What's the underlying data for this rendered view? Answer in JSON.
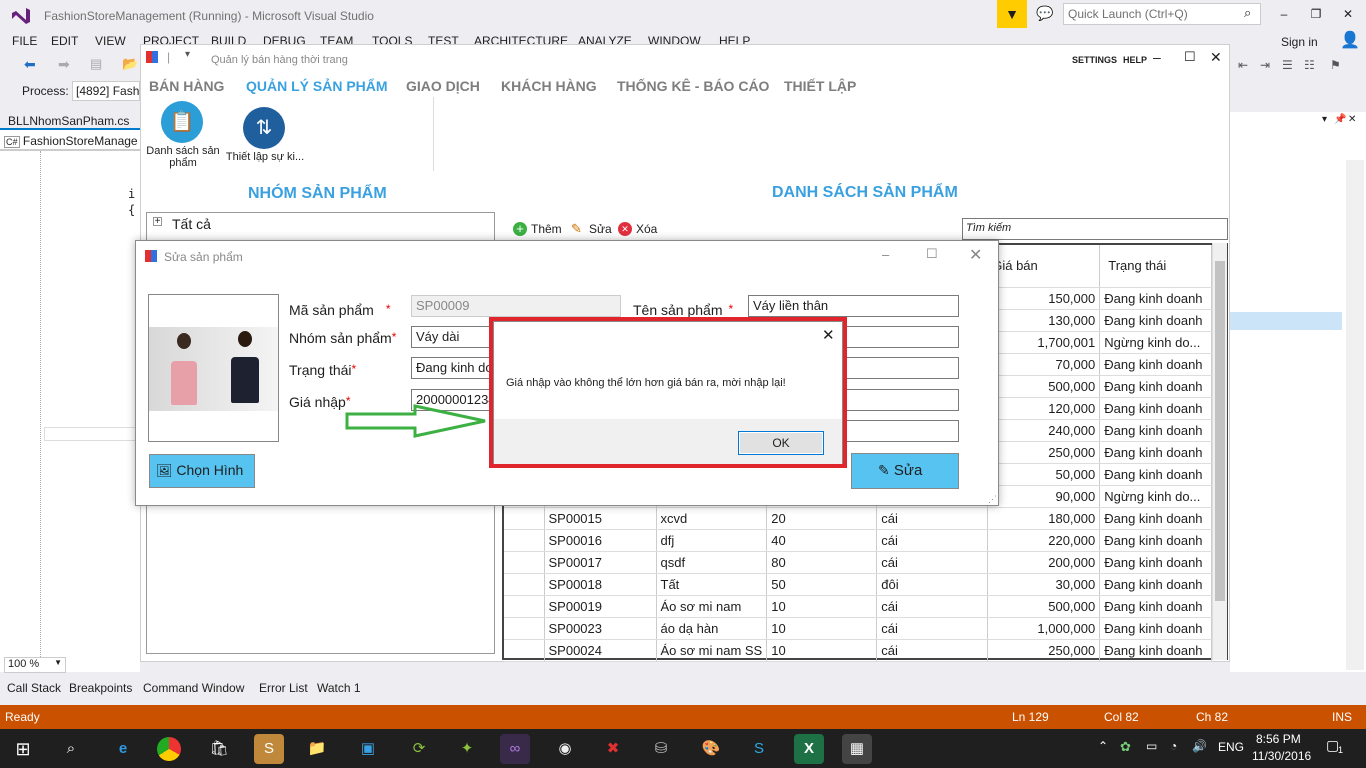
{
  "vs": {
    "title": "FashionStoreManagement (Running) - Microsoft Visual Studio",
    "quick_launch_placeholder": "Quick Launch (Ctrl+Q)",
    "sign_in": "Sign in",
    "menu": [
      "FILE",
      "EDIT",
      "VIEW",
      "PROJECT",
      "BUILD",
      "DEBUG",
      "TEAM",
      "TOOLS",
      "TEST",
      "ARCHITECTURE",
      "ANALYZE",
      "WINDOW",
      "HELP"
    ],
    "process_label": "Process:",
    "process_value": "[4892] Fashi",
    "doc_tab": "BLLNhomSanPham.cs",
    "doc_nav": "FashionStoreManage",
    "code_line1": "i",
    "code_line2": "{",
    "zoom": "100 %",
    "bottom_tabs": [
      "Call Stack",
      "Breakpoints",
      "Command Window",
      "Error List",
      "Watch 1"
    ],
    "status": {
      "ready": "Ready",
      "ln": "Ln 129",
      "col": "Col 82",
      "ch": "Ch 82",
      "ins": "INS"
    }
  },
  "app": {
    "title": "Quản lý bán hàng thời trang",
    "settings": "SETTINGS",
    "help": "HELP",
    "nav": [
      "BÁN HÀNG",
      "QUẢN LÝ SẢN PHẨM",
      "GIAO DỊCH",
      "KHÁCH HÀNG",
      "THỐNG KÊ - BÁO CÁO",
      "THIẾT LẬP"
    ],
    "ribbon": [
      {
        "label": "Danh sách sản phẩm",
        "icon": "clipboard-list-icon"
      },
      {
        "label": "Thiết lập sự ki...",
        "icon": "sort-arrows-icon"
      }
    ],
    "group_title": "NHÓM SẢN PHẨM",
    "list_title": "DANH SÁCH SẢN PHẨM",
    "tree_root": "Tất cả",
    "toolbar": {
      "add": "Thêm",
      "edit": "Sửa",
      "delete": "Xóa"
    },
    "search_placeholder": "Tìm kiếm",
    "columns": {
      "price": "Giá bán",
      "status": "Trạng thái"
    },
    "partial_rows": [
      {
        "price": "150,000",
        "status": "Đang kinh doanh"
      },
      {
        "price": "130,000",
        "status": "Đang kinh doanh"
      },
      {
        "price": "1,700,001",
        "status": "Ngừng kinh do..."
      },
      {
        "price": "70,000",
        "status": "Đang kinh doanh"
      },
      {
        "price": "500,000",
        "status": "Đang kinh doanh"
      },
      {
        "price": "120,000",
        "status": "Đang kinh doanh"
      },
      {
        "price": "240,000",
        "status": "Đang kinh doanh"
      },
      {
        "price": "250,000",
        "status": "Đang kinh doanh"
      },
      {
        "price": "50,000",
        "status": "Đang kinh doanh"
      },
      {
        "price": "90,000",
        "status": "Ngừng kinh do..."
      }
    ],
    "rows": [
      {
        "code": "SP00015",
        "name": "xcvd",
        "qty": "20",
        "unit": "cái",
        "price": "180,000",
        "status": "Đang kinh doanh"
      },
      {
        "code": "SP00016",
        "name": "dfj",
        "qty": "40",
        "unit": "cái",
        "price": "220,000",
        "status": "Đang kinh doanh"
      },
      {
        "code": "SP00017",
        "name": "qsdf",
        "qty": "80",
        "unit": "cái",
        "price": "200,000",
        "status": "Đang kinh doanh"
      },
      {
        "code": "SP00018",
        "name": "Tất",
        "qty": "50",
        "unit": "đôi",
        "price": "30,000",
        "status": "Đang kinh doanh"
      },
      {
        "code": "SP00019",
        "name": "Áo sơ mi nam",
        "qty": "10",
        "unit": "cái",
        "price": "500,000",
        "status": "Đang kinh doanh"
      },
      {
        "code": "SP00023",
        "name": "áo dạ hàn",
        "qty": "10",
        "unit": "cái",
        "price": "1,000,000",
        "status": "Đang kinh doanh"
      },
      {
        "code": "SP00024",
        "name": "Áo sơ mi nam SS",
        "qty": "10",
        "unit": "cái",
        "price": "250,000",
        "status": "Đang kinh doanh"
      }
    ]
  },
  "edit_dialog": {
    "title": "Sửa sản phẩm",
    "labels": {
      "code": "Mã sản phẩm",
      "group": "Nhóm sản phẩm",
      "state": "Trạng thái",
      "cost": "Giá nhập",
      "name": "Tên sản phẩm"
    },
    "values": {
      "code": "SP00009",
      "group": "Váy dài",
      "state": "Đang kinh do",
      "cost": "200000012345",
      "name": "Váy liền thân"
    },
    "choose_image": "Chọn Hình",
    "save": "Sửa"
  },
  "message_box": {
    "text": "Giá nhập vào không thể lớn hơn giá bán ra, mời nhập lại!",
    "ok": "OK"
  },
  "taskbar": {
    "language": "ENG",
    "time": "8:56 PM",
    "date": "11/30/2016",
    "notifications": "1"
  },
  "colors": {
    "accent": "#3aa1e0",
    "highlight_border": "#e0262c",
    "arrow": "#3cb043",
    "status_bar": "#ca5100"
  }
}
